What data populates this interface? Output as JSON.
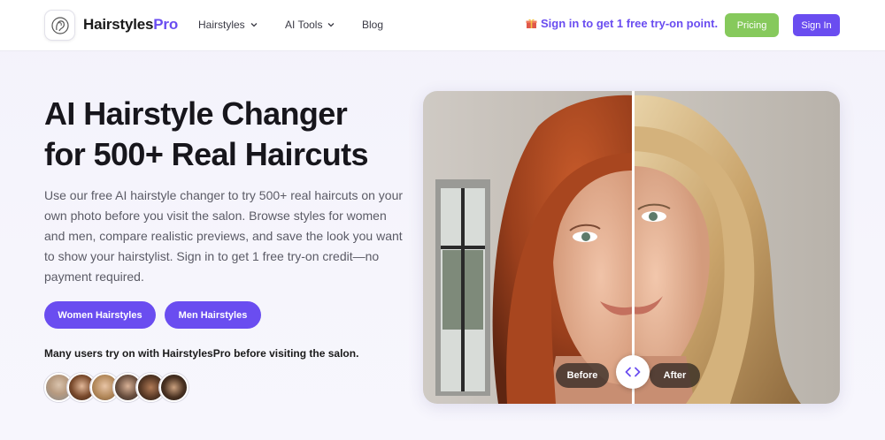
{
  "nav": {
    "brand_part1": "Hairstyles",
    "brand_part2": "Pro",
    "links": [
      {
        "label": "Hairstyles",
        "icon": "chevron-down-icon"
      },
      {
        "label": "AI Tools",
        "icon": "chevron-down-icon"
      },
      {
        "label": "Blog"
      }
    ],
    "promo_icon": "gift-icon",
    "promo_text": "Sign in to get 1 free try-on point.",
    "pricing_label": "Pricing",
    "signin_label": "Sign In"
  },
  "hero": {
    "title_line1": "AI Hairstyle Changer",
    "title_line2": "for 500+ Real Haircuts",
    "description": "Use our free AI hairstyle changer to try 500+ real haircuts on your own photo before you visit the salon. Browse styles for women and men, compare realistic previews, and save the look you want to show your hairstylist. Sign in to get 1 free try-on credit—no payment required.",
    "cta_women": "Women Hairstyles",
    "cta_men": "Men Hairstyles",
    "users_text": "Many users try on with HairstylesPro before visiting the salon."
  },
  "comparison": {
    "before_label": "Before",
    "after_label": "After",
    "handle_icon": "chevron-left-right-icon"
  },
  "colors": {
    "accent": "#6a4df0",
    "pricing": "#86c95c"
  }
}
